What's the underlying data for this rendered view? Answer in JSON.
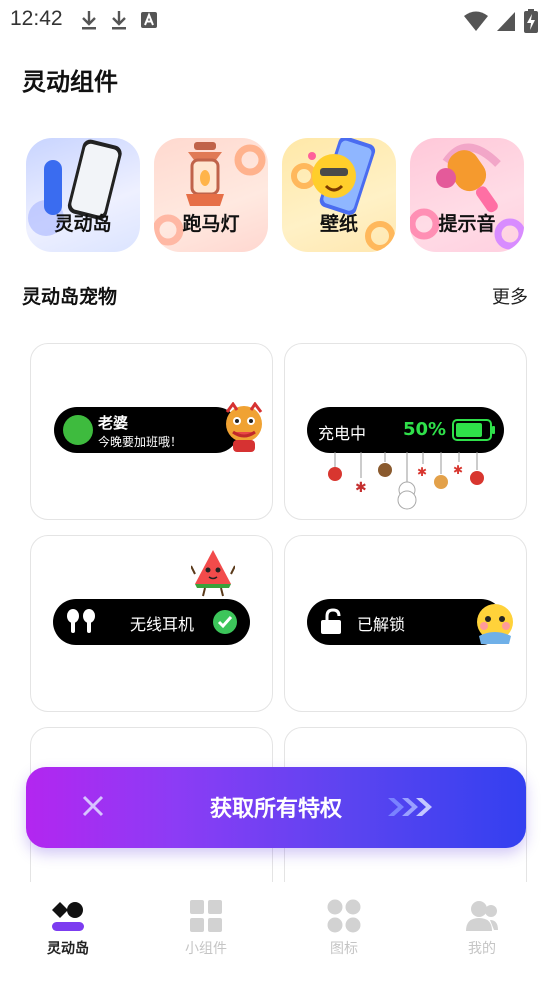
{
  "status_bar": {
    "time": "12:42",
    "icons_left": [
      "download-icon",
      "download-icon",
      "text-a-icon"
    ],
    "icons_right": [
      "wifi-icon",
      "signal-icon",
      "battery-charging-icon"
    ]
  },
  "page_title": "灵动组件",
  "categories": [
    {
      "label": "灵动岛",
      "icon": "phone-icon",
      "color": "#c8d4ff"
    },
    {
      "label": "跑马灯",
      "icon": "lantern-icon",
      "color": "#ffd9cf"
    },
    {
      "label": "壁纸",
      "icon": "emoji-phone-icon",
      "color": "#ffe8a8"
    },
    {
      "label": "提示音",
      "icon": "microphone-icon",
      "color": "#ffc8d9"
    }
  ],
  "section": {
    "title": "灵动岛宠物",
    "more_label": "更多"
  },
  "cards": [
    {
      "name": "老婆",
      "message": "今晚要加班哦！",
      "sticker": "lion-dance-icon"
    },
    {
      "status": "充电中",
      "percent": "50%",
      "decoration": "christmas-ornaments-icon"
    },
    {
      "label": "无线耳机",
      "sticker": "watermelon-character-icon",
      "check_icon": "check-circle-icon"
    },
    {
      "label": "已解锁",
      "sticker": "emoji-face-icon",
      "lock_icon": "unlock-icon"
    }
  ],
  "promo": {
    "text": "获取所有特权",
    "accent_start": "#b326f0",
    "accent_end": "#3340f0"
  },
  "bottom_nav": [
    {
      "label": "灵动岛",
      "icon": "island-icon",
      "active": true
    },
    {
      "label": "小组件",
      "icon": "widget-grid-icon",
      "active": false
    },
    {
      "label": "图标",
      "icon": "dots-grid-icon",
      "active": false
    },
    {
      "label": "我的",
      "icon": "user-icon",
      "active": false
    }
  ]
}
